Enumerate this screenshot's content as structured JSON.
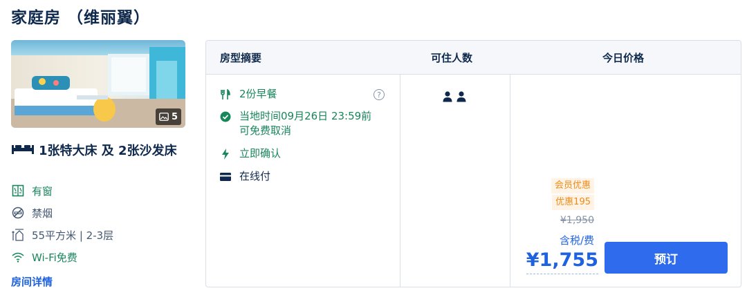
{
  "room": {
    "title": "家庭房 （维丽翼）",
    "photo_count": "5",
    "bed": "1张特大床 及 2张沙发床",
    "features": {
      "window": "有窗",
      "smoking": "禁烟",
      "area": "55平方米 | 2-3层",
      "wifi": "Wi-Fi免费"
    },
    "details_link": "房间详情"
  },
  "table": {
    "headers": {
      "summary": "房型摘要",
      "guests": "可住人数",
      "price": "今日价格"
    },
    "policies": {
      "breakfast": "2份早餐",
      "cancel": "当地时间09月26日 23:59前可免费取消",
      "confirm": "立即确认",
      "payment": "在线付"
    },
    "guest_count": 2,
    "promo": {
      "label": "会员优惠",
      "discount": "优惠195"
    },
    "original_price": "¥1,950",
    "tax_note": "含税/费",
    "price": "¥1,755",
    "book_label": "预订"
  },
  "colors": {
    "accent": "#1f62e0",
    "button": "#2f6bed",
    "green": "#18865b",
    "promo": "#f08a17"
  },
  "icons": [
    "image-icon",
    "bed-icon",
    "window-icon",
    "no-smoking-icon",
    "area-icon",
    "wifi-icon",
    "cutlery-icon",
    "check-circle-icon",
    "lightning-icon",
    "card-icon",
    "help-icon",
    "person-icon"
  ]
}
